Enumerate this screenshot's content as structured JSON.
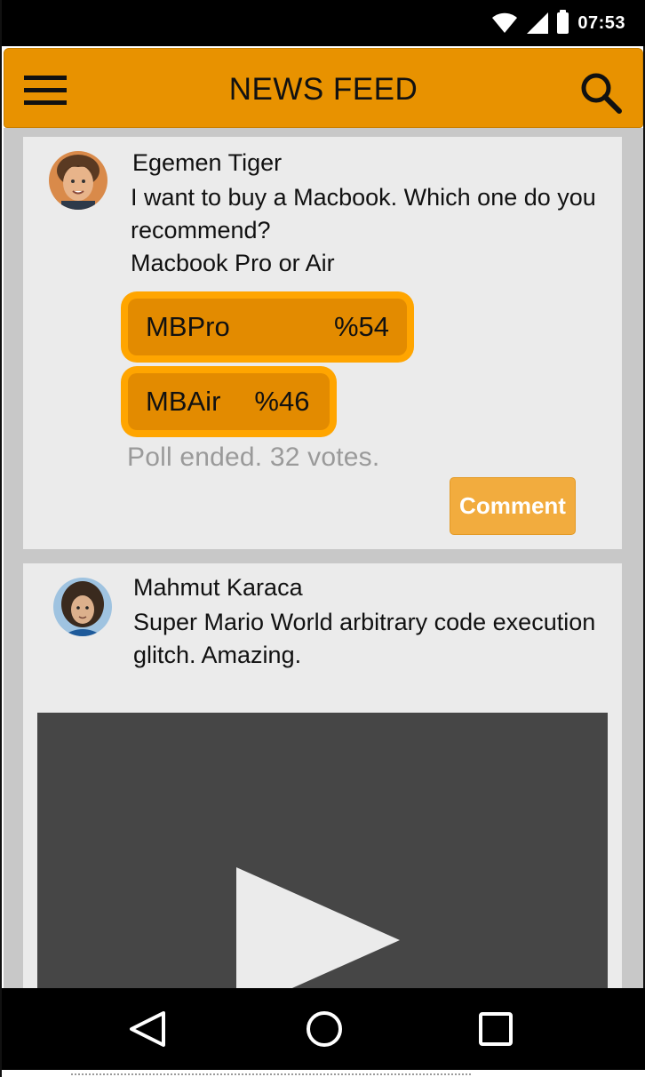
{
  "status_bar": {
    "time": "07:53"
  },
  "app_bar": {
    "title": "NEWS FEED",
    "menu_icon": "hamburger-icon",
    "search_icon": "search-icon"
  },
  "feed": {
    "posts": [
      {
        "author": "Egemen Tiger",
        "text": "I want to buy a Macbook. Which one do you recommend?\nMacbook Pro or Air",
        "poll": {
          "options": [
            {
              "label": "MBPro",
              "percent": "%54"
            },
            {
              "label": "MBAir",
              "percent": "%46"
            }
          ],
          "status": "Poll ended. 32 votes."
        },
        "comment_label": "Comment"
      },
      {
        "author": "Mahmut Karaca",
        "text": "Super Mario World arbitrary code execution glitch. Amazing.",
        "media": "video",
        "play_icon": "play-icon"
      }
    ]
  },
  "nav_bar": {
    "icons": [
      "back-icon",
      "home-icon",
      "recents-icon"
    ]
  },
  "colors": {
    "accent": "#E89200",
    "poll_option": "#FFA500",
    "comment_button": "#F2AC3E"
  }
}
